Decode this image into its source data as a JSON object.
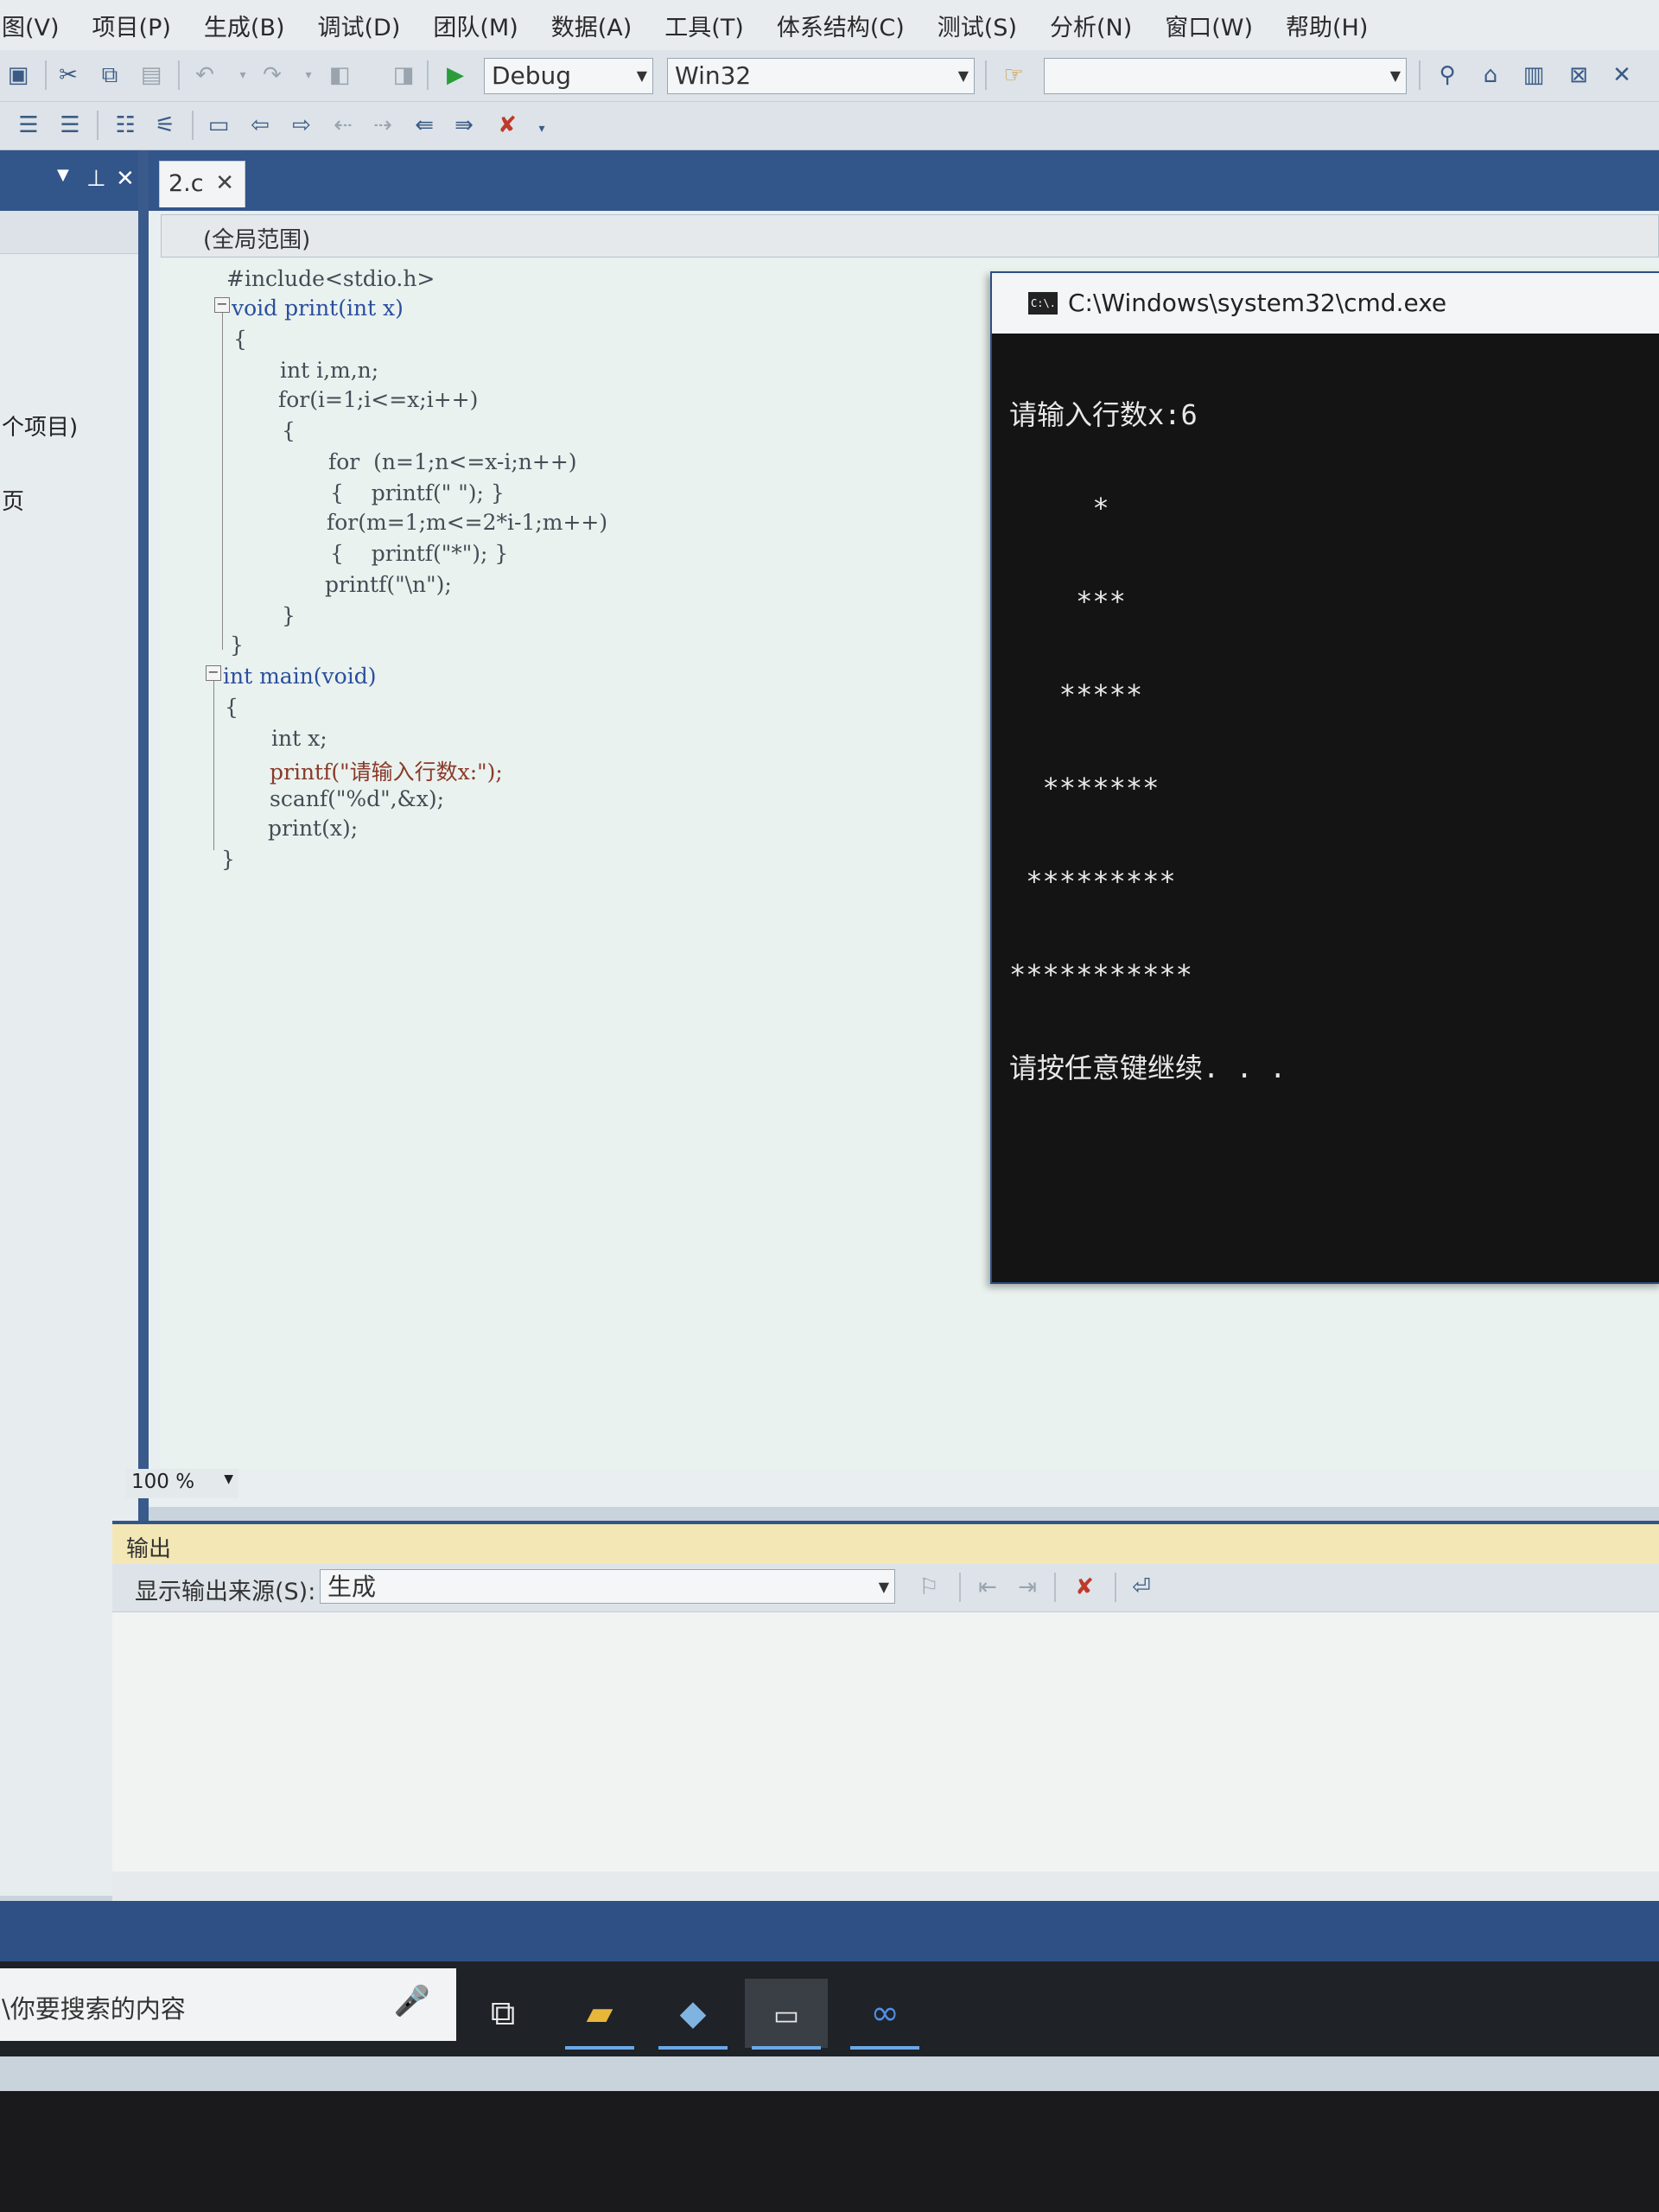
{
  "menu": [
    "图(V)",
    "项目(P)",
    "生成(B)",
    "调试(D)",
    "团队(M)",
    "数据(A)",
    "工具(T)",
    "体系结构(C)",
    "测试(S)",
    "分析(N)",
    "窗口(W)",
    "帮助(H)"
  ],
  "toolbar": {
    "config": "Debug",
    "platform": "Win32",
    "find_value": ""
  },
  "left_panel": {
    "item1": "个项目)",
    "item2": "页"
  },
  "editor": {
    "tab_label": "2.c",
    "scope": "(全局范围)",
    "zoom": "100 %",
    "code": [
      "#include<stdio.h>",
      "void print(int x)",
      "{",
      "int i,m,n;",
      "for(i=1;i<=x;i++)",
      "{",
      "for  (n=1;n<=x-i;n++)",
      "{    printf(\" \"); }",
      "for(m=1;m<=2*i-1;m++)",
      "{    printf(\"*\"); }",
      "printf(\"\\n\");",
      "}",
      "}",
      "int main(void)",
      "{",
      "int x;",
      "printf(\"请输入行数x:\");",
      "scanf(\"%d\",&x);",
      "print(x);",
      "}"
    ]
  },
  "console": {
    "title": "C:\\Windows\\system32\\cmd.exe",
    "icon_label": "C:\\.",
    "lines": [
      "请输入行数x:6",
      "     *",
      "    ***",
      "   *****",
      "  *******",
      " *********",
      "***********",
      "请按任意键继续. . ."
    ]
  },
  "output": {
    "title": "输出",
    "source_label": "显示输出来源(S):",
    "source_value": "生成"
  },
  "taskbar": {
    "search_placeholder": "\\你要搜索的内容"
  },
  "colors": {
    "accent": "#32558a",
    "console_bg": "#141414"
  }
}
